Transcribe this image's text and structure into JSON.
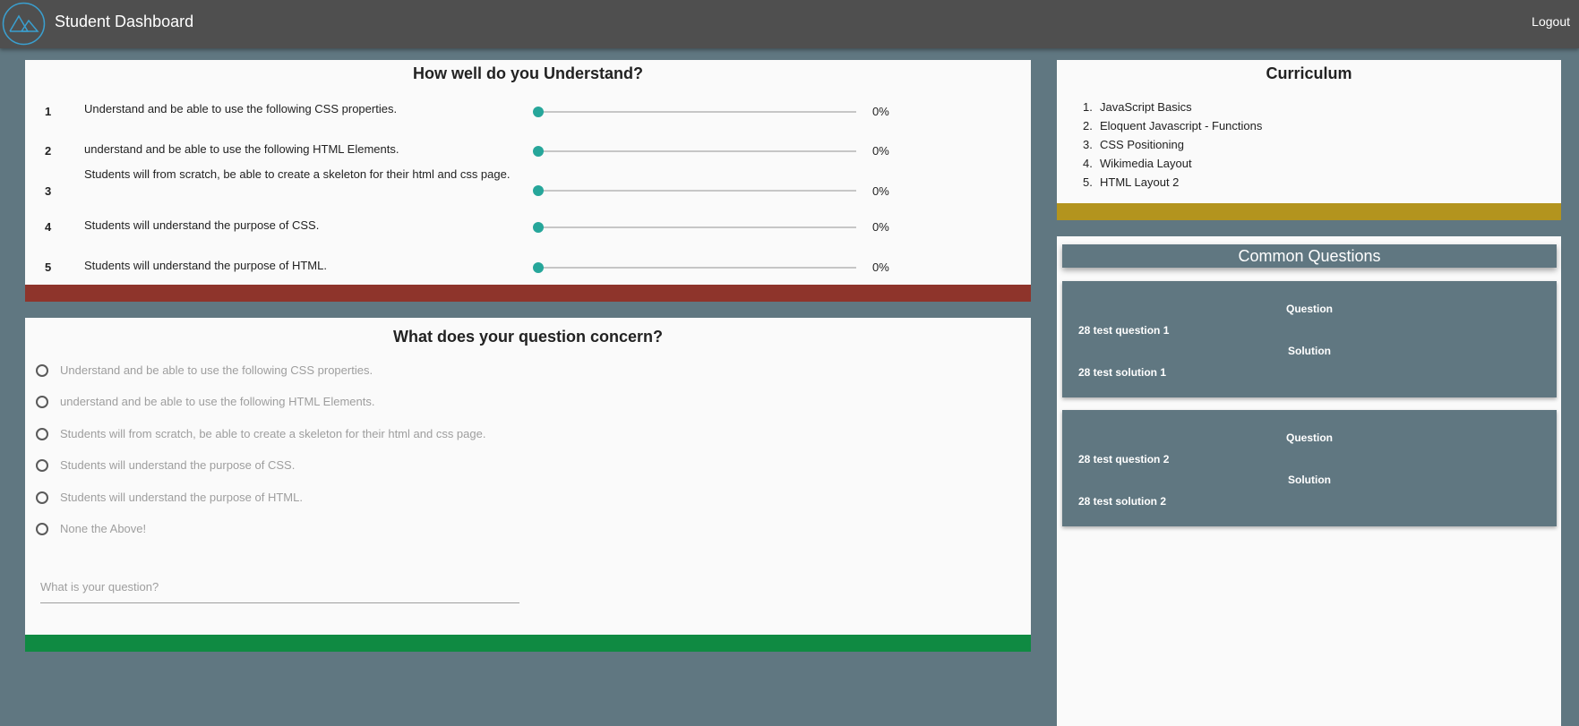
{
  "header": {
    "title": "Student Dashboard",
    "logout_label": "Logout",
    "logo_icon": "mountain-logo-icon"
  },
  "understand": {
    "title": "How well do you Understand?",
    "items": [
      {
        "num": "1",
        "text": "Understand and be able to use the following CSS properties.",
        "level": 0,
        "value": "0%"
      },
      {
        "num": "2",
        "text": "understand and be able to use the following HTML Elements.",
        "level": 0,
        "value": "0%"
      },
      {
        "num": "3",
        "text": "Students will from scratch, be able to create a skeleton for their html and css page.",
        "level": 0,
        "value": "0%"
      },
      {
        "num": "4",
        "text": "Students will understand the purpose of CSS.",
        "level": 0,
        "value": "0%"
      },
      {
        "num": "5",
        "text": "Students will understand the purpose of HTML.",
        "level": 0,
        "value": "0%"
      }
    ],
    "accent_color": "#8e342b"
  },
  "concern": {
    "title": "What does your question concern?",
    "options": [
      "Understand and be able to use the following CSS properties.",
      "understand and be able to use the following HTML Elements.",
      "Students will from scratch, be able to create a skeleton for their html and css page.",
      "Students will understand the purpose of CSS.",
      "Students will understand the purpose of HTML.",
      "None the Above!"
    ],
    "question_placeholder": "What is your question?",
    "accent_color": "#0f8a42"
  },
  "curriculum": {
    "title": "Curriculum",
    "items": [
      {
        "idx": "1.",
        "label": "JavaScript Basics"
      },
      {
        "idx": "2.",
        "label": "Eloquent Javascript - Functions"
      },
      {
        "idx": "3.",
        "label": "CSS Positioning"
      },
      {
        "idx": "4.",
        "label": "Wikimedia Layout"
      },
      {
        "idx": "5.",
        "label": "HTML Layout 2"
      }
    ],
    "accent_color": "#b3941e"
  },
  "common_questions": {
    "title": "Common Questions",
    "cards": [
      {
        "question_label": "Question",
        "question": "28 test question 1",
        "solution_label": "Solution",
        "solution": "28 test solution 1"
      },
      {
        "question_label": "Question",
        "question": "28 test question 2",
        "solution_label": "Solution",
        "solution": "28 test solution 2"
      }
    ]
  },
  "colors": {
    "slider_accent": "#26a69a",
    "background": "#607781",
    "topbar": "#4f4f4f",
    "logo_stroke": "#3a9fcf"
  }
}
